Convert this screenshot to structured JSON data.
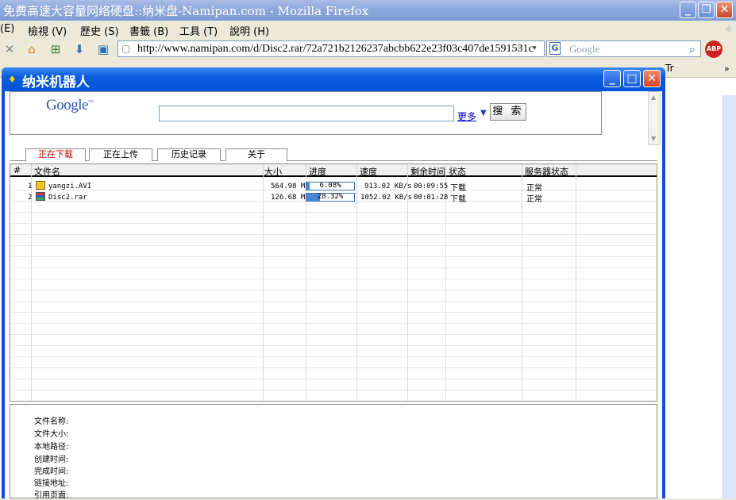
{
  "firefox": {
    "title": "免费高速大容量网络硬盘::纳米盘-Namipan.com - Mozilla Firefox",
    "menu": [
      "(E)",
      "檢視 (V)",
      "歷史 (S)",
      "書籤 (B)",
      "工具 (T)",
      "說明 (H)"
    ],
    "url": "http://www.namipan.com/d/Disc2.rar/72a721b2126237abcbb622e23f03c407de1591531c",
    "search_placeholder": "Google",
    "bookmark_tail": "Tr"
  },
  "popup": {
    "title": "纳米机器人"
  },
  "google": {
    "logo": "Google",
    "more_link": "更多",
    "search_button": "搜 索"
  },
  "tabs": [
    {
      "label": "正在下载",
      "active": true
    },
    {
      "label": "正在上传",
      "active": false
    },
    {
      "label": "历史记录",
      "active": false
    },
    {
      "label": "关于",
      "active": false
    }
  ],
  "table": {
    "headers": [
      "#",
      "文件名",
      "大小",
      "进度",
      "速度",
      "剩余时间",
      "状态",
      "服务器状态"
    ],
    "rows": [
      {
        "index": "1",
        "name": "yangzi.AVI",
        "size": "564.98 MB",
        "progress_text": "6.08%",
        "progress": 0.0608,
        "speed": "913.02 KB/s",
        "remaining": "00:09:55",
        "status": "下载",
        "server": "正常",
        "icon": "video-file-icon"
      },
      {
        "index": "2",
        "name": "Disc2.rar",
        "size": "126.68 MB",
        "progress_text": "28.32%",
        "progress": 0.2832,
        "speed": "1052.02 KB/s",
        "remaining": "00:01:28",
        "status": "下载",
        "server": "正常",
        "icon": "rar-file-icon"
      }
    ]
  },
  "details": {
    "labels": [
      "文件名称:",
      "文件大小:",
      "本地路径:",
      "创建时间:",
      "完成时间:",
      "链接地址:",
      "引用页面:"
    ]
  }
}
